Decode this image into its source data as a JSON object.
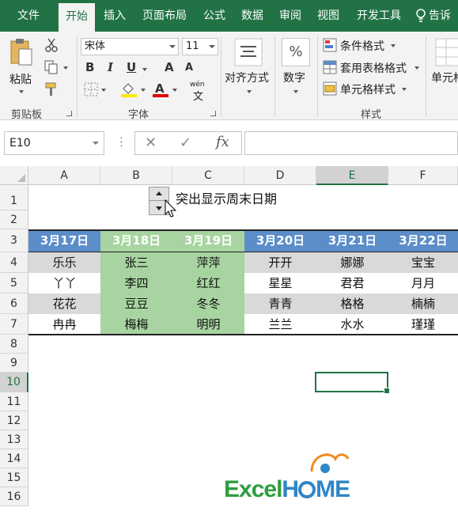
{
  "ribbon_tabs": [
    "文件",
    "开始",
    "插入",
    "页面布局",
    "公式",
    "数据",
    "审阅",
    "视图",
    "开发工具",
    "告诉"
  ],
  "active_tab": "开始",
  "clipboard": {
    "paste": "粘贴",
    "group": "剪贴板"
  },
  "font": {
    "name": "宋体",
    "size": "11",
    "bold": "B",
    "italic": "I",
    "underline": "U",
    "grow": "A",
    "shrink": "A",
    "wen": "wén",
    "wen_char": "文",
    "group": "字体"
  },
  "align": {
    "label": "对齐方式"
  },
  "number": {
    "symbol": "%",
    "label": "数字"
  },
  "styles": {
    "conditional": "条件格式",
    "table": "套用表格格式",
    "cell": "单元格样式",
    "group": "样式"
  },
  "cells": {
    "label": "单元格"
  },
  "formula_bar": {
    "name_box": "E10",
    "fx": "fx",
    "cancel": "✕",
    "enter": "✓",
    "dots": "⋮"
  },
  "columns": [
    "A",
    "B",
    "C",
    "D",
    "E",
    "F"
  ],
  "selected_column": "E",
  "rows": [
    "1",
    "2",
    "3",
    "4",
    "5",
    "6",
    "7",
    "8",
    "9",
    "10",
    "11",
    "12",
    "13",
    "14",
    "15",
    "16"
  ],
  "selected_row": "10",
  "sheet_title": "突出显示周末日期",
  "date_headers": [
    "3月17日",
    "3月18日",
    "3月19日",
    "3月20日",
    "3月21日",
    "3月22日"
  ],
  "names": [
    [
      "乐乐",
      "张三",
      "萍萍",
      "开开",
      "娜娜",
      "宝宝"
    ],
    [
      "丫丫",
      "李四",
      "红红",
      "星星",
      "君君",
      "月月"
    ],
    [
      "花花",
      "豆豆",
      "冬冬",
      "青青",
      "格格",
      "楠楠"
    ],
    [
      "冉冉",
      "梅梅",
      "明明",
      "兰兰",
      "水水",
      "瑾瑾"
    ]
  ],
  "logo": {
    "part1": "Excel",
    "part2": "H",
    "part3": "ME"
  },
  "colors": {
    "excel_green": "#217346",
    "header_blue": "#5b8dc9",
    "weekend_green": "#a7d4a0",
    "stripe_gray": "#d9d9d9",
    "logo_green": "#2e9d3f",
    "logo_blue": "#2f86c8",
    "logo_orange": "#f08a1d"
  }
}
